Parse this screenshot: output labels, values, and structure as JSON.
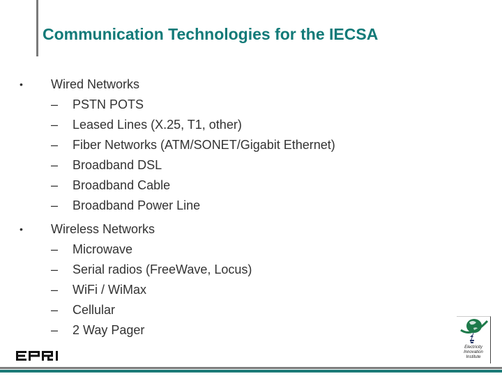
{
  "slide": {
    "title": "Communication Technologies for the IECSA",
    "accent_color": "#127a78",
    "sections": [
      {
        "bullet": "•",
        "label": "Wired Networks",
        "items": [
          "PSTN POTS",
          "Leased Lines (X.25, T1, other)",
          "Fiber Networks (ATM/SONET/Gigabit Ethernet)",
          "Broadband DSL",
          "Broadband Cable",
          "Broadband Power Line"
        ]
      },
      {
        "bullet": "•",
        "label": "Wireless Networks",
        "items": [
          "Microwave",
          "Serial radios (FreeWave, Locus)",
          "WiFi / WiMax",
          "Cellular",
          "2 Way Pager"
        ]
      }
    ],
    "dash": "–"
  },
  "footer": {
    "left_logo": "EPRI",
    "right_logo": {
      "icon": "globe-icon",
      "line1": "Electricity",
      "line2": "Innovation",
      "line3": "Institute"
    }
  }
}
